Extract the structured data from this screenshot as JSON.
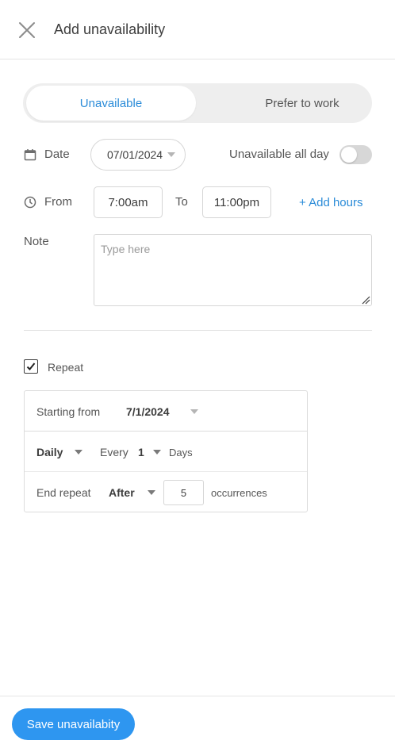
{
  "header": {
    "title": "Add unavailability"
  },
  "mode_toggle": {
    "options": [
      "Unavailable",
      "Prefer to work"
    ],
    "selected": "Unavailable"
  },
  "date_row": {
    "label": "Date",
    "value": "07/01/2024",
    "all_day_label": "Unavailable all day",
    "all_day_enabled": false
  },
  "time_row": {
    "from_label": "From",
    "from_value": "7:00am",
    "to_label": "To",
    "to_value": "11:00pm",
    "add_hours_label": "+ Add hours"
  },
  "note": {
    "label": "Note",
    "placeholder": "Type here",
    "value": ""
  },
  "repeat": {
    "label": "Repeat",
    "checked": true,
    "starting_from_label": "Starting from",
    "starting_from_value": "7/1/2024",
    "frequency": "Daily",
    "every_label": "Every",
    "every_value": "1",
    "unit_label": "Days",
    "end_repeat_label": "End repeat",
    "end_repeat_mode": "After",
    "occurrences_value": "5",
    "occurrences_label": "occurrences"
  },
  "footer": {
    "save_label": "Save unavailabity"
  },
  "colors": {
    "accent": "#2a8bd8",
    "button": "#2e96f0",
    "toggle_off": "#d7d7d7"
  }
}
